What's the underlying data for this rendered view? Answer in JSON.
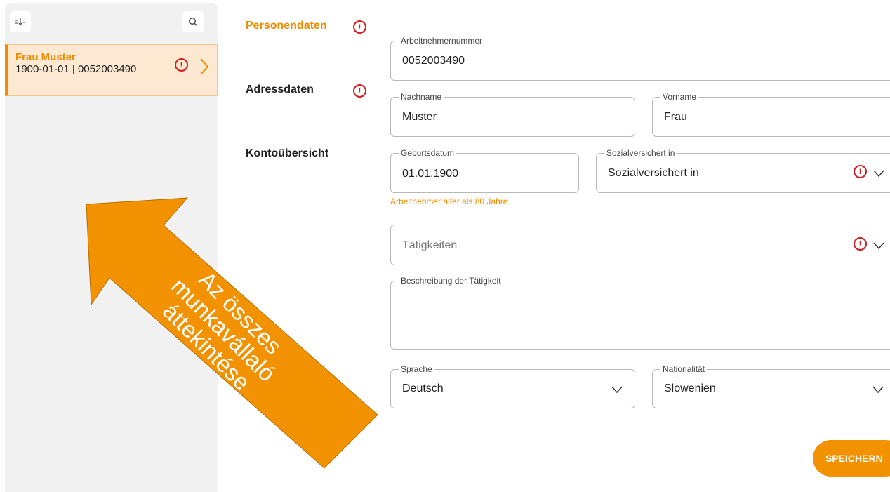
{
  "sidebar": {
    "sort_icon": "sort-icon",
    "search_icon": "search-icon",
    "employee": {
      "name": "Frau Muster",
      "meta": "1900-01-01 | 0052003490",
      "alert": "!"
    }
  },
  "nav": {
    "personendaten": "Personendaten",
    "adressdaten": "Adressdaten",
    "kontouebersicht": "Kontoübersicht",
    "alert": "!"
  },
  "form": {
    "arbeitnehmernummer": {
      "label": "Arbeitnehmernummer",
      "value": "0052003490"
    },
    "nachname": {
      "label": "Nachname",
      "value": "Muster"
    },
    "vorname": {
      "label": "Vorname",
      "value": "Frau"
    },
    "geburtsdatum": {
      "label": "Geburtsdatum",
      "value": "01.01.1900",
      "hint": "Arbeitnehmer älter als 80 Jahre"
    },
    "sozialversichert": {
      "label": "Sozialversichert in",
      "placeholder": "Sozialversichert in"
    },
    "taetigkeiten": {
      "placeholder": "Tätigkeiten"
    },
    "beschreibung": {
      "label": "Beschreibung der Tätigkeit",
      "value": ""
    },
    "sprache": {
      "label": "Sprache",
      "value": "Deutsch"
    },
    "nationalitaet": {
      "label": "Nationalität",
      "value": "Slowenien"
    },
    "alert": "!"
  },
  "actions": {
    "save_label": "SPEICHERN"
  },
  "annotation": {
    "text": "Az összes munkavállaló áttekintése",
    "color": "#f39200"
  },
  "colors": {
    "accent": "#f08c00",
    "error": "#d71920",
    "selected_bg": "#fde9d2"
  }
}
